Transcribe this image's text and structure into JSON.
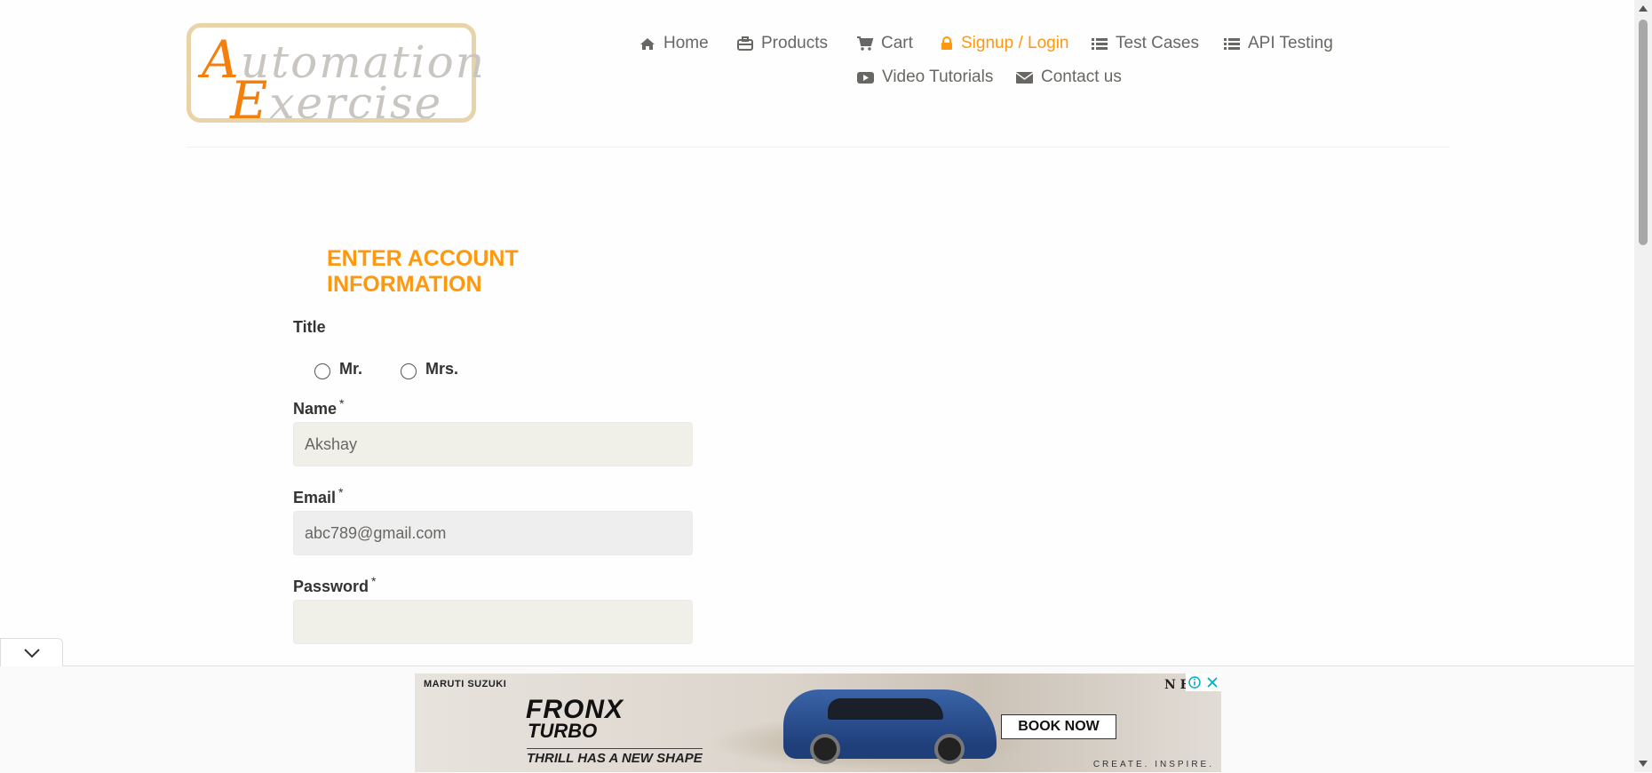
{
  "logo": {
    "line1_cap": "A",
    "line1_rest": "utomation",
    "line2_cap": "E",
    "line2_rest": "xercise"
  },
  "nav": {
    "items": [
      {
        "label": "Home",
        "icon": "home-icon"
      },
      {
        "label": "Products",
        "icon": "briefcase-icon"
      },
      {
        "label": "Cart",
        "icon": "cart-icon"
      },
      {
        "label": "Signup / Login",
        "icon": "lock-icon",
        "active": true
      },
      {
        "label": "Test Cases",
        "icon": "list-icon"
      },
      {
        "label": "API Testing",
        "icon": "list-icon"
      },
      {
        "label": "Video Tutorials",
        "icon": "youtube-play-icon"
      },
      {
        "label": "Contact us",
        "icon": "envelope-icon"
      }
    ],
    "active_color": "#fe980f"
  },
  "form": {
    "heading": "ENTER ACCOUNT INFORMATION",
    "title_label": "Title",
    "title_options": [
      "Mr.",
      "Mrs."
    ],
    "name_label": "Name",
    "name_value": "Akshay",
    "email_label": "Email",
    "email_value": "abc789@gmail.com",
    "password_label": "Password",
    "password_value": "",
    "required_mark": "*"
  },
  "ad": {
    "brand": "MARUTI SUZUKI",
    "model": "FRONX",
    "variant": "TURBO",
    "tagline": "THRILL HAS A NEW SHAPE",
    "cta": "BOOK NOW",
    "sub": "CREATE. INSPIRE.",
    "corner": "N E"
  },
  "colors": {
    "accent": "#fe980f",
    "text": "#696763",
    "field_bg": "#f0f0e9"
  }
}
